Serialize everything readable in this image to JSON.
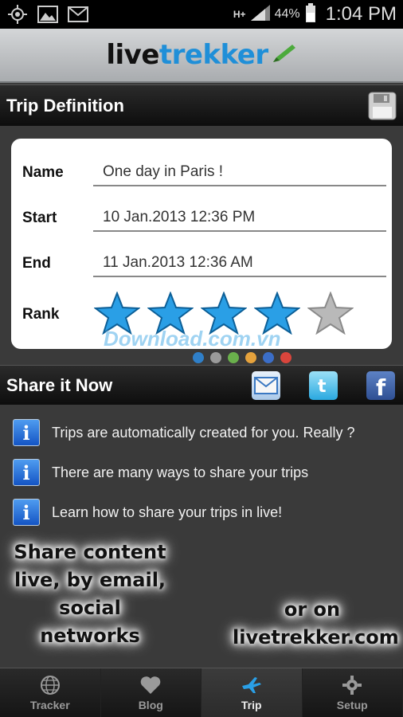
{
  "status_bar": {
    "network": "H+",
    "battery_percent": "44%",
    "time": "1:04 PM",
    "icons": [
      "gps-icon",
      "gallery-icon",
      "gmail-icon",
      "signal-icon",
      "battery-icon"
    ]
  },
  "header": {
    "logo_part1": "live",
    "logo_part2": "trekker"
  },
  "trip_definition": {
    "title": "Trip Definition",
    "fields": [
      {
        "label": "Name",
        "value": "One day in Paris !"
      },
      {
        "label": "Start",
        "value": "10 Jan.2013 12:36 PM"
      },
      {
        "label": "End",
        "value": "11 Jan.2013 12:36 AM"
      }
    ],
    "rank_label": "Rank",
    "rank": 4,
    "rank_max": 5
  },
  "watermark": {
    "text": "Download.com.vn",
    "dot_colors": [
      "#2f7fc8",
      "#9a9a9a",
      "#6ab04c",
      "#e6a23c",
      "#3b6ec8",
      "#d9453c"
    ]
  },
  "share": {
    "title": "Share it Now",
    "buttons": [
      "email",
      "twitter",
      "facebook"
    ]
  },
  "info_items": [
    "Trips are automatically created for you. Really ?",
    "There are many ways to share your trips",
    "Learn how to share your trips in live!"
  ],
  "promo": {
    "left_lines": [
      "Share content",
      "live, by email,",
      "social networks"
    ],
    "right_lines": [
      "or on",
      "livetrekker.com"
    ]
  },
  "bottom_nav": {
    "tabs": [
      "Tracker",
      "Blog",
      "Trip",
      "Setup"
    ],
    "active": "Trip"
  },
  "colors": {
    "accent": "#1f8fd8",
    "star_filled": "#2a9fe6",
    "star_empty": "#b9b9b9"
  }
}
